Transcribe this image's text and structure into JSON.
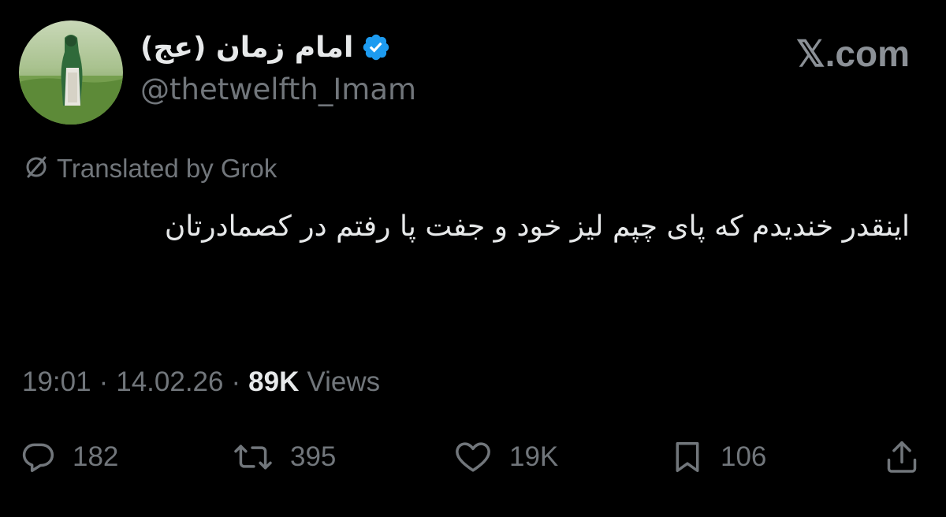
{
  "tweet": {
    "display_name": "امام زمان (عج)",
    "handle": "@thetwelfth_Imam",
    "translated_label": "Translated by Grok",
    "body": "اینقدر خندیدم که پای چپم لیز خود و جفت پا رفتم در کصمادرتان",
    "time": "19:01",
    "date": "14.02.26",
    "views_count": "89K",
    "views_label": "Views"
  },
  "brand": {
    "text": "𝕏.com"
  },
  "actions": {
    "replies": "182",
    "reposts": "395",
    "likes": "19K",
    "bookmarks": "106"
  },
  "colors": {
    "background": "#000000",
    "text_primary": "#e7e9ea",
    "text_secondary": "#71767b",
    "verified": "#1d9bf0"
  },
  "icons": [
    "verified-badge-icon",
    "translate-icon",
    "reply-icon",
    "repost-icon",
    "like-icon",
    "bookmark-icon",
    "share-icon"
  ]
}
